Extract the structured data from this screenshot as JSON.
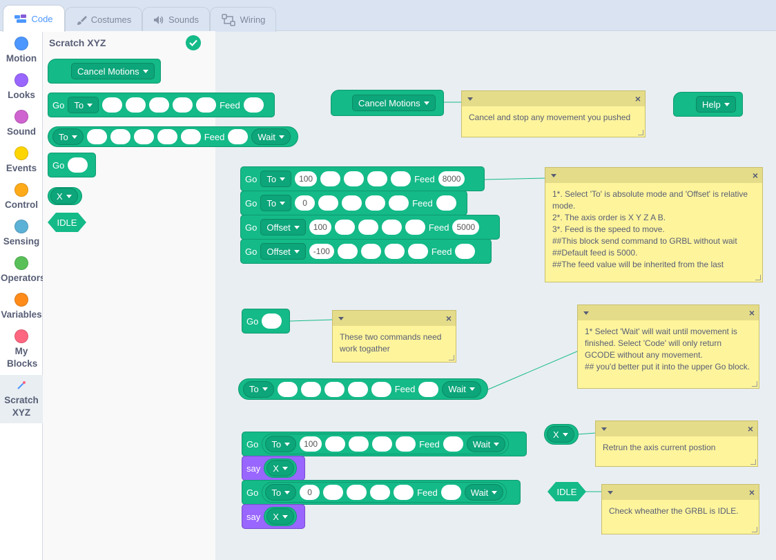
{
  "tabs": [
    {
      "label": "Code",
      "icon": "code-icon"
    },
    {
      "label": "Costumes",
      "icon": "brush-icon"
    },
    {
      "label": "Sounds",
      "icon": "speaker-icon"
    },
    {
      "label": "Wiring",
      "icon": "wiring-icon"
    }
  ],
  "categories": [
    {
      "label": "Motion",
      "color": "#4c97ff"
    },
    {
      "label": "Looks",
      "color": "#9966ff"
    },
    {
      "label": "Sound",
      "color": "#cf63cf"
    },
    {
      "label": "Events",
      "color": "#ffd500"
    },
    {
      "label": "Control",
      "color": "#ffab19"
    },
    {
      "label": "Sensing",
      "color": "#5cb1d6"
    },
    {
      "label": "Operators",
      "color": "#59c059"
    },
    {
      "label": "Variables",
      "color": "#ff8c1a"
    },
    {
      "label": "My Blocks",
      "color": "#ff6680"
    },
    {
      "label": "Scratch XYZ",
      "color": ""
    }
  ],
  "palette": {
    "title": "Scratch XYZ",
    "cancel": "Cancel Motions",
    "go": "Go",
    "to": "To",
    "feed": "Feed",
    "wait": "Wait",
    "x": "X",
    "idle": "IDLE"
  },
  "ws": {
    "cancel": "Cancel Motions",
    "help": "Help",
    "go": "Go",
    "to": "To",
    "offset": "Offset",
    "feed": "Feed",
    "wait": "Wait",
    "say": "say",
    "x": "X",
    "idle": "IDLE",
    "r1": {
      "v": "100",
      "feed": "8000"
    },
    "r2": {
      "v": "0"
    },
    "r3": {
      "v": "100",
      "feed": "5000"
    },
    "r4": {
      "v": "-100"
    },
    "g1": {
      "v": "100"
    },
    "g2": {
      "v": "0"
    }
  },
  "notes": {
    "n1": "Cancel and stop any movement you pushed",
    "n2": "1*. Select  'To' is absolute mode and 'Offset' is relative mode.\n2*. The axis order is X Y Z A B.\n3*. Feed is the speed to move.\n##This block send command to GRBL without wait\n##Default feed is 5000.\n##The feed value will be inherited from the last",
    "n3": "These two commands need work togather",
    "n4": "1* Select 'Wait' will wait until movement is finished. Select 'Code' will only return GCODE without any movement.\n## you'd better put it into the upper Go block.",
    "n5": "Retrun the axis current postion",
    "n6": "Check wheather the GRBL is IDLE."
  }
}
